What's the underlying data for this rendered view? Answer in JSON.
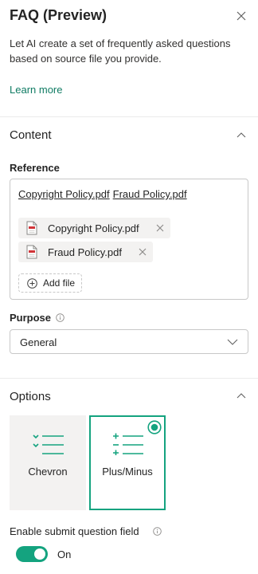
{
  "header": {
    "title": "FAQ (Preview)",
    "description": "Let AI create a set of frequently asked questions based on source file you provide.",
    "learn_more": "Learn more"
  },
  "content_section": {
    "title": "Content",
    "reference": {
      "label": "Reference",
      "links": [
        "Copyright Policy.pdf",
        "Fraud Policy.pdf"
      ],
      "files": [
        {
          "name": "Copyright Policy.pdf",
          "icon": "pdf-file-icon"
        },
        {
          "name": "Fraud Policy.pdf",
          "icon": "pdf-file-icon"
        }
      ],
      "add_file_label": "Add file"
    },
    "purpose": {
      "label": "Purpose",
      "selected": "General"
    }
  },
  "options_section": {
    "title": "Options",
    "styles": [
      {
        "label": "Chevron",
        "icon": "chevron-list-icon",
        "selected": false
      },
      {
        "label": "Plus/Minus",
        "icon": "plus-minus-list-icon",
        "selected": true
      }
    ],
    "submit_question": {
      "label": "Enable submit question field",
      "enabled": true,
      "state_label": "On"
    }
  },
  "colors": {
    "accent": "#14a37f",
    "link": "#0f7b63",
    "tile_bg": "#f3f2f1",
    "border": "#c8c8c8",
    "divider": "#ebebeb"
  }
}
